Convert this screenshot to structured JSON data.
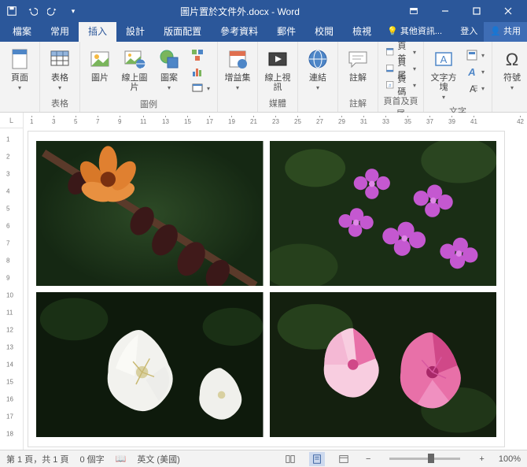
{
  "title": "圖片置於文件外.docx - Word",
  "tabs": {
    "file": "檔案",
    "home": "常用",
    "insert": "插入",
    "design": "設計",
    "layout": "版面配置",
    "references": "參考資料",
    "mailings": "郵件",
    "review": "校閱",
    "view": "檢視",
    "tellme": "其他資訊...",
    "signin": "登入",
    "share": "共用"
  },
  "ribbon": {
    "pages": {
      "cover": "頁面",
      "groupLabel": ""
    },
    "tables": {
      "table": "表格",
      "groupLabel": "表格"
    },
    "illustrations": {
      "pictures": "圖片",
      "online": "線上圖片",
      "shapes": "圖案",
      "groupLabel": "圖例"
    },
    "addins": {
      "addins": "增益集",
      "groupLabel": ""
    },
    "media": {
      "video": "線上視訊",
      "groupLabel": "媒體"
    },
    "links": {
      "links": "連結",
      "groupLabel": ""
    },
    "comments": {
      "comment": "註解",
      "groupLabel": "註解"
    },
    "headerfooter": {
      "header": "頁首",
      "footer": "頁尾",
      "pagenum": "頁碼",
      "groupLabel": "頁首及頁尾"
    },
    "text": {
      "textbox": "文字方塊",
      "groupLabel": "文字"
    },
    "symbols": {
      "symbol": "符號",
      "groupLabel": ""
    }
  },
  "ruler_h": [
    1,
    3,
    5,
    7,
    9,
    11,
    13,
    15,
    17,
    19,
    21,
    23,
    25,
    27,
    29,
    31,
    33,
    35,
    37,
    39,
    41
  ],
  "ruler_right": 42,
  "ruler_v": [
    1,
    2,
    3,
    4,
    5,
    6,
    7,
    8,
    9,
    10,
    11,
    12,
    13,
    14,
    15,
    16,
    17,
    18
  ],
  "statusbar": {
    "page": "第 1 頁，共 1 頁",
    "words": "0 個字",
    "lang": "英文 (美國)",
    "zoom": "100%"
  }
}
